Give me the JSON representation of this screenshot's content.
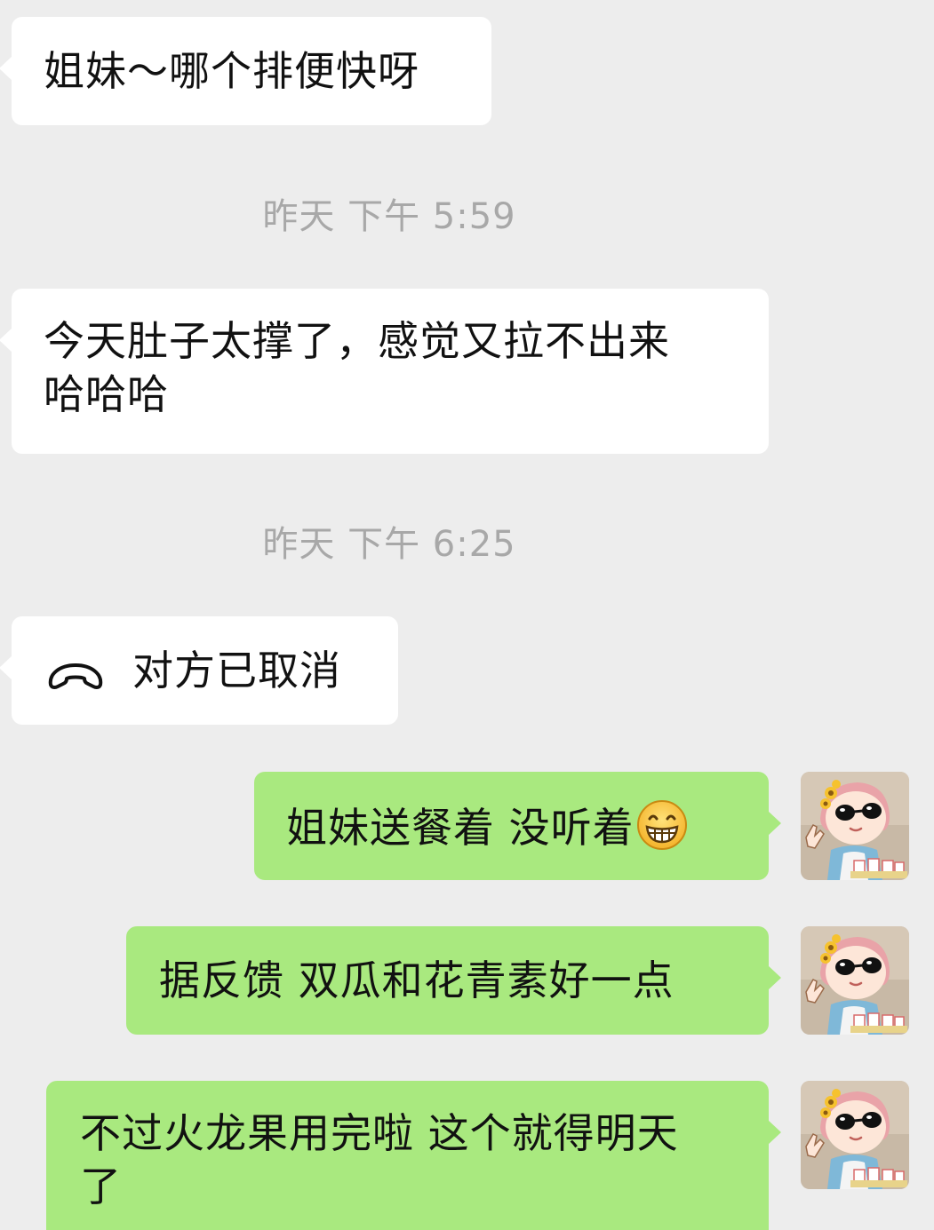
{
  "chat": {
    "timestamps": [
      "昨天 下午 5:59",
      "昨天 下午 6:25"
    ],
    "messages": [
      {
        "from": "other",
        "text": "姐妹～哪个排便快呀"
      },
      {
        "from": "other",
        "text": "今天肚子太撑了，感觉又拉不出来\n哈哈哈"
      },
      {
        "from": "other",
        "type": "call",
        "text": "对方已取消",
        "icon": "hang-up-phone-icon"
      },
      {
        "from": "me",
        "text": "姐妹送餐着 没听着",
        "emoji": "grin-emoji"
      },
      {
        "from": "me",
        "text": "据反馈 双瓜和花青素好一点"
      },
      {
        "from": "me",
        "text": "不过火龙果用完啦 这个就得明天\n了"
      }
    ]
  },
  "avatar": {
    "icon": "sunglasses-girl-avatar"
  },
  "colors": {
    "background": "#ededed",
    "incoming_bubble": "#ffffff",
    "outgoing_bubble": "#a9e97f",
    "timestamp_text": "#a8a8a8",
    "message_text": "#111111"
  }
}
